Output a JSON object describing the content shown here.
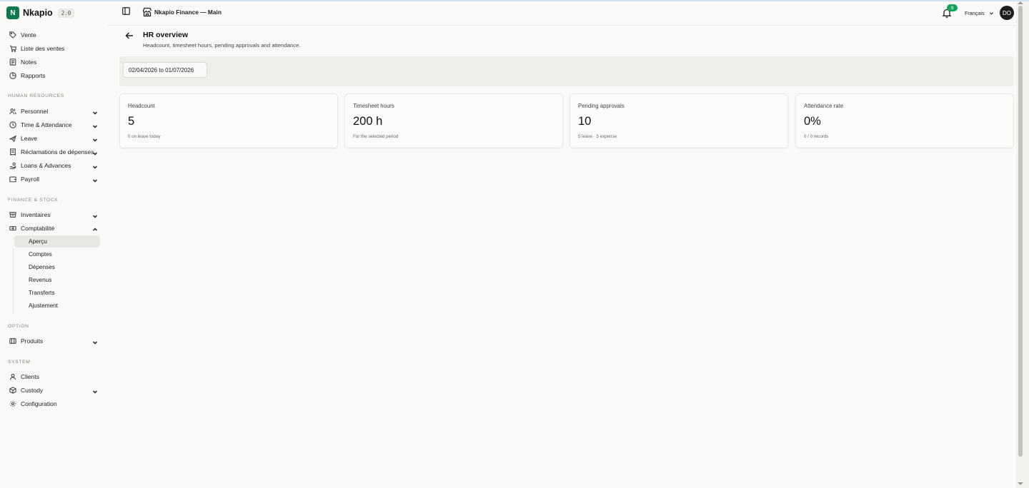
{
  "brand": {
    "name": "Nkapio",
    "version": "2.0",
    "logo_letter": "N",
    "accent": "#0f7a4d"
  },
  "sidebar": {
    "top_items": [
      {
        "label": "Vente",
        "icon": "tag-icon"
      },
      {
        "label": "Liste des ventes",
        "icon": "cart-icon"
      },
      {
        "label": "Notes",
        "icon": "notes-icon"
      },
      {
        "label": "Rapports",
        "icon": "report-icon"
      }
    ],
    "sections": [
      {
        "title": "HUMAN RESOURCES"
      },
      {
        "title": "FINANCE & STOCK"
      },
      {
        "title": "OPTION"
      },
      {
        "title": "SYSTEM"
      }
    ],
    "hr_items": [
      {
        "label": "Personnel"
      },
      {
        "label": "Time & Attendance"
      },
      {
        "label": "Leave"
      },
      {
        "label": "Réclamations de dépenses"
      },
      {
        "label": "Loans & Advances"
      },
      {
        "label": "Payroll"
      }
    ],
    "finance_items": [
      {
        "label": "Inventaires"
      },
      {
        "label": "Comptabilité"
      }
    ],
    "accounting_subitems": [
      {
        "label": "Aperçu",
        "active": true
      },
      {
        "label": "Comptes"
      },
      {
        "label": "Dépenses"
      },
      {
        "label": "Revenus"
      },
      {
        "label": "Transferts"
      },
      {
        "label": "Ajustement"
      }
    ],
    "option_items": [
      {
        "label": "Produits"
      }
    ],
    "system_items": [
      {
        "label": "Clients"
      },
      {
        "label": "Custody"
      },
      {
        "label": "Configuration"
      }
    ]
  },
  "header": {
    "store_name": "Nkapio Finance — Main",
    "notification_count": "9",
    "language": "Français",
    "avatar_initials": "DO"
  },
  "page": {
    "title": "HR overview",
    "subtitle": "Headcount, timesheet hours, pending approvals and attendance.",
    "date_range": "02/04/2026 to 01/07/2026"
  },
  "cards": [
    {
      "label": "Headcount",
      "value": "5",
      "note": "0 on leave today"
    },
    {
      "label": "Timesheet hours",
      "value": "200 h",
      "note": "For the selected period"
    },
    {
      "label": "Pending approvals",
      "value": "10",
      "note": "5 leave · 5 expense"
    },
    {
      "label": "Attendance rate",
      "value": "0%",
      "note": "0 / 0 records"
    }
  ]
}
